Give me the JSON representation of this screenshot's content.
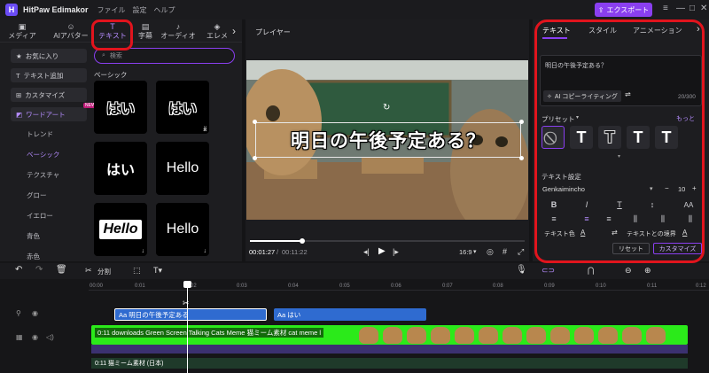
{
  "titlebar": {
    "app_title": "HitPaw Edimakor",
    "menu": [
      "ファイル",
      "設定",
      "ヘルプ"
    ],
    "export_label": "エクスポート",
    "logo_glyph": "H"
  },
  "media_tabs": [
    {
      "label": "メディア",
      "icon": "media-icon"
    },
    {
      "label": "AIアバター",
      "icon": "avatar-icon"
    },
    {
      "label": "テキスト",
      "icon": "text-icon"
    },
    {
      "label": "字幕",
      "icon": "subtitle-icon"
    },
    {
      "label": "オーディオ",
      "icon": "audio-icon"
    },
    {
      "label": "エレメ",
      "icon": "element-icon"
    }
  ],
  "sidebar": {
    "items": [
      {
        "label": "お気に入り",
        "icon": "star-icon"
      },
      {
        "label": "テキスト追加",
        "icon": "add-text-icon"
      },
      {
        "label": "カスタマイズ",
        "icon": "customize-icon"
      },
      {
        "label": "ワードアート",
        "icon": "wordart-icon",
        "badge": "NEW"
      }
    ],
    "subitems": [
      "トレンド",
      "ベーシック",
      "テクスチャ",
      "グロー",
      "イエロー",
      "青色",
      "赤色"
    ]
  },
  "library": {
    "search_placeholder": "検索",
    "section_title": "ベーシック",
    "cards": [
      {
        "text": "はい"
      },
      {
        "text": "はい"
      },
      {
        "text": "はい"
      },
      {
        "text": "Hello"
      },
      {
        "text": "Hello"
      },
      {
        "text": "Hello"
      }
    ]
  },
  "player": {
    "title": "プレイヤー",
    "overlay_text": "明日の午後予定ある？",
    "current_time": "00:01:27",
    "total_time": "00:11:22",
    "aspect": "16:9",
    "progress": 0.19
  },
  "inspector": {
    "tabs": [
      "テキスト",
      "スタイル",
      "アニメーション"
    ],
    "text_value": "明日の午後予定ある？",
    "ai_button": "AI コピーライティング",
    "char_count": "20/300",
    "preset_label": "プリセット",
    "more_label": "もっと",
    "text_settings_label": "テキスト設定",
    "font_name": "Genkaiminchо",
    "font_size": "10",
    "text_color_label": "テキスト色",
    "spacing_label": "テキストとの境界",
    "reset_label": "リセット",
    "customize_label": "カスタマイズ"
  },
  "toolbar": {
    "split_label": "分割"
  },
  "timeline": {
    "ruler": [
      "00:00",
      "0:01",
      "0:02",
      "0:03",
      "0:04",
      "0:05",
      "0:06",
      "0:07",
      "0:08",
      "0:09",
      "0:10",
      "0:11",
      "0:12"
    ],
    "text_clips": [
      {
        "label": "Aa 明日の午後予定ある"
      },
      {
        "label": "Aa はい"
      }
    ],
    "video_clip": "0:11 downloads Green Screen Talking Cats Meme  猫ミーム素材 cat meme l",
    "audio_clip": "0:11 猫ミーム素材 (日本)"
  },
  "colors": {
    "accent": "#8a3ff0",
    "highlight_red": "#e1141d",
    "text_clip": "#2f6bd0",
    "green_screen": "#2bea1a"
  }
}
